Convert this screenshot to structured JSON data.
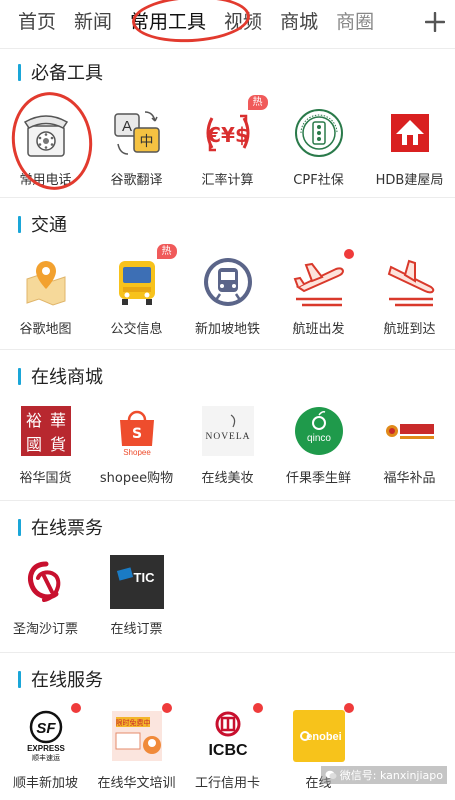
{
  "tabs": [
    {
      "label": "首页"
    },
    {
      "label": "新闻"
    },
    {
      "label": "常用工具",
      "active": true
    },
    {
      "label": "视频"
    },
    {
      "label": "商城"
    },
    {
      "label": "商圈"
    }
  ],
  "add_tab_icon": "plus-icon",
  "accent_color": "#1aa6d8",
  "annotation_color": "#e23a2e",
  "sections": [
    {
      "title": "必备工具",
      "items": [
        {
          "label": "常用电话",
          "icon": "telephone-icon"
        },
        {
          "label": "谷歌翻译",
          "icon": "translate-icon"
        },
        {
          "label": "汇率计算",
          "icon": "currency-icon",
          "badge": "热"
        },
        {
          "label": "CPF社保",
          "icon": "cpf-seal-icon"
        },
        {
          "label": "HDB建屋局",
          "icon": "hdb-house-icon"
        }
      ]
    },
    {
      "title": "交通",
      "items": [
        {
          "label": "谷歌地图",
          "icon": "map-pin-icon"
        },
        {
          "label": "公交信息",
          "icon": "bus-icon",
          "badge": "热"
        },
        {
          "label": "新加坡地铁",
          "icon": "train-icon"
        },
        {
          "label": "航班出发",
          "icon": "plane-depart-icon",
          "dot": true
        },
        {
          "label": "航班到达",
          "icon": "plane-arrive-icon"
        }
      ]
    },
    {
      "title": "在线商城",
      "items": [
        {
          "label": "裕华国货",
          "icon": "yuhua-logo-icon",
          "logo_text": [
            "裕",
            "華",
            "國",
            "貨"
          ]
        },
        {
          "label": "shopee购物",
          "icon": "shopee-bag-icon",
          "logo_text": "Shopee"
        },
        {
          "label": "在线美妆",
          "icon": "novela-logo-icon",
          "logo_text": "NOVELA"
        },
        {
          "label": "仟果季生鲜",
          "icon": "qinco-logo-icon",
          "logo_text": "qinco"
        },
        {
          "label": "福华补品",
          "icon": "fuhua-logo-icon"
        }
      ]
    },
    {
      "title": "在线票务",
      "items": [
        {
          "label": "圣淘沙订票",
          "icon": "sentosa-logo-icon"
        },
        {
          "label": "在线订票",
          "icon": "sistic-logo-icon",
          "logo_text": "TIC"
        }
      ]
    },
    {
      "title": "在线服务",
      "items": [
        {
          "label": "顺丰新加坡",
          "icon": "sf-express-icon",
          "logo_text": [
            "SF",
            "EXPRESS",
            "顺丰速运"
          ],
          "dot": true
        },
        {
          "label": "在线华文培训",
          "icon": "chinese-training-icon",
          "logo_text": "限时免费中",
          "dot": true
        },
        {
          "label": "工行信用卡",
          "icon": "icbc-logo-icon",
          "logo_text": "ICBC",
          "dot": true
        },
        {
          "label": "在线",
          "icon": "enobei-logo-icon",
          "logo_text": "enobei",
          "dot": true
        }
      ]
    }
  ],
  "watermark": "微信号: kanxinjiapo"
}
